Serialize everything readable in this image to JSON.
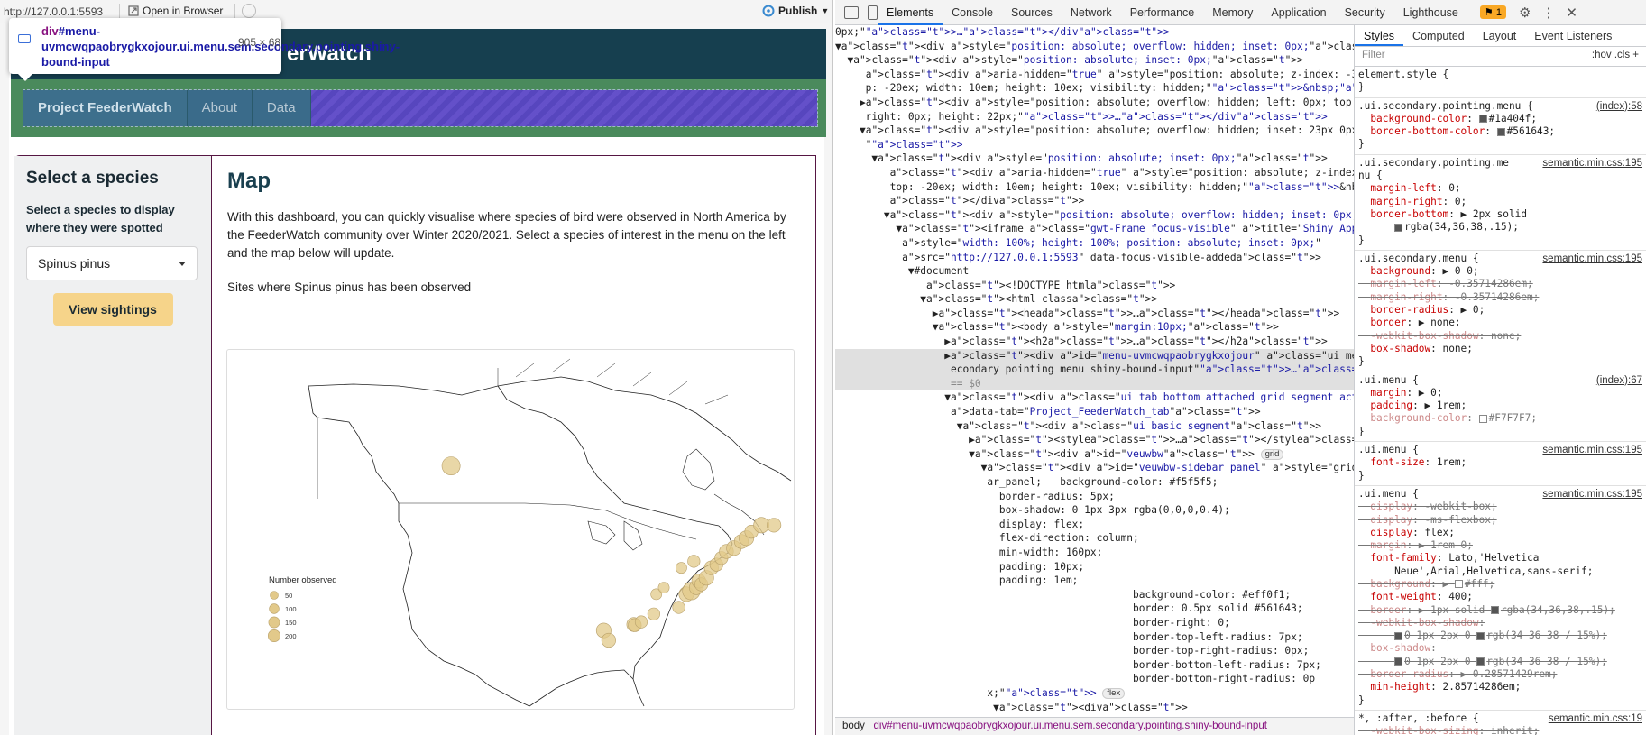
{
  "viewer": {
    "url": "http://127.0.0.1:5593",
    "open_in_browser": "Open in Browser",
    "publish": "Publish"
  },
  "tooltip": {
    "selector_tag": "div",
    "selector_rest": "#menu-uvmcwqpaobrygkxojour.ui.menu.sem.secondary.pointing.shiny-bound-input",
    "size": "905 × 68"
  },
  "app": {
    "title": "erWatch",
    "menu": [
      "Project FeederWatch",
      "About",
      "Data"
    ],
    "sidebar": {
      "heading": "Select a species",
      "label": "Select a species to display where they were spotted",
      "selected": "Spinus pinus",
      "button": "View sightings"
    },
    "main": {
      "heading": "Map",
      "intro": "With this dashboard, you can quickly visualise where species of bird were observed in North America by the FeederWatch community over Winter 2020/2021. Select a species of interest in the menu on the left and the map below will update.",
      "sites_text": "Sites where Spinus pinus has been observed"
    },
    "legend": {
      "title": "Number observed",
      "values": [
        "50",
        "100",
        "150",
        "200"
      ]
    }
  },
  "devtools": {
    "tabs": [
      "Elements",
      "Console",
      "Sources",
      "Network",
      "Performance",
      "Memory",
      "Application",
      "Security",
      "Lighthouse"
    ],
    "issues_badge": "1",
    "breadcrumb": [
      "body",
      "div#menu-uvmcwqpaobrygkxojour.ui.menu.sem.secondary.pointing.shiny-bound-input"
    ],
    "style_tabs": [
      "Styles",
      "Computed",
      "Layout",
      "Event Listeners"
    ],
    "filter_placeholder": "Filter",
    "filter_right": ":hov  .cls  +",
    "dom_lines": [
      "0px;\">…</div>",
      "▼<div style=\"position: absolute; overflow: hidden; inset: 0px;\">",
      "  ▼<div style=\"position: absolute; inset: 0px;\">",
      "     <div aria-hidden=\"true\" style=\"position: absolute; z-index: -32767; to",
      "     p: -20ex; width: 10em; height: 10ex; visibility: hidden;\">&nbsp;</div>",
      "    ▶<div style=\"position: absolute; overflow: hidden; left: 0px; top: 0px;",
      "     right: 0px; height: 22px;\">…</div>",
      "    ▼<div style=\"position: absolute; overflow: hidden; inset: 23px 0px 0px;",
      "     \">",
      "      ▼<div style=\"position: absolute; inset: 0px;\">",
      "         <div aria-hidden=\"true\" style=\"position: absolute; z-index: -32767;",
      "         top: -20ex; width: 10em; height: 10ex; visibility: hidden;\">&nbsp;",
      "         </div>",
      "        ▼<div style=\"position: absolute; overflow: hidden; inset: 0px;\">",
      "          ▼<iframe class=\"gwt-Frame focus-visible\" title=\"Shiny Application\"",
      "           style=\"width: 100%; height: 100%; position: absolute; inset: 0px;\"",
      "           src=\"http://127.0.0.1:5593\" data-focus-visible-added>",
      "            ▼#document",
      "               <!DOCTYPE html>",
      "              ▼<html class>",
      "                ▶<head>…</head>",
      "                ▼<body style=\"margin:10px;\">",
      "                  ▶<h2>…</h2>",
      "                  ▶<div id=\"menu-uvmcwqpaobrygkxojour\" class=\"ui menu sem ui s",
      "                   econdary pointing menu shiny-bound-input\">…</div> flex",
      "                   == $0",
      "                  ▼<div class=\"ui tab bottom attached grid segment active\"",
      "                   data-tab=\"Project_FeederWatch_tab\">",
      "                    ▼<div class=\"ui basic segment\">",
      "                      ▶<style>…</style>",
      "                      ▼<div id=\"veuwbw\"> grid",
      "                        ▼<div id=\"veuwbw-sidebar_panel\" style=\"grid-area: sideb",
      "                         ar_panel;   background-color: #f5f5f5;",
      "                           border-radius: 5px;",
      "                           box-shadow: 0 1px 3px rgba(0,0,0,0.4);",
      "                           display: flex;",
      "                           flex-direction: column;",
      "                           min-width: 160px;",
      "                           padding: 10px;",
      "                           padding: 1em;",
      "                                                 background-color: #eff0f1;",
      "                                                 border: 0.5px solid #561643;",
      "                                                 border-right: 0;",
      "                                                 border-top-left-radius: 7px;",
      "                                                 border-top-right-radius: 0px;",
      "                                                 border-bottom-left-radius: 7px;",
      "                                                 border-bottom-right-radius: 0p",
      "                         x;\"> flex",
      "                          ▼<div>"
    ],
    "rules": [
      {
        "sel": "element.style {",
        "src": "",
        "props": [
          "}"
        ]
      },
      {
        "sel": ".ui.secondary.pointing.menu {",
        "src": "(index):58",
        "props": [
          "  background-color: ■#1a404f;",
          "  border-bottom-color: ■#561643;",
          "}"
        ]
      },
      {
        "sel": ".ui.secondary.pointing.me",
        "src": "semantic.min.css:195",
        "props": [
          "nu {",
          "  margin-left: 0;",
          "  margin-right: 0;",
          "  border-bottom: ▶ 2px solid",
          "      ■rgba(34,36,38,.15);",
          "}"
        ]
      },
      {
        "sel": ".ui.secondary.menu {",
        "src": "semantic.min.css:195",
        "props": [
          "  background: ▶ 0 0;",
          "~  margin-left: -0.35714286em;",
          "~  margin-right: -0.35714286em;",
          "  border-radius: ▶ 0;",
          "  border: ▶ none;",
          "~  -webkit-box-shadow: none;",
          "  box-shadow: none;",
          "}"
        ]
      },
      {
        "sel": ".ui.menu {",
        "src": "(index):67",
        "props": [
          "  margin: ▶ 0;",
          "  padding: ▶ 1rem;",
          "~  background-color: □#F7F7F7;",
          "}"
        ]
      },
      {
        "sel": ".ui.menu {",
        "src": "semantic.min.css:195",
        "props": [
          "  font-size: 1rem;",
          "}"
        ]
      },
      {
        "sel": ".ui.menu {",
        "src": "semantic.min.css:195",
        "props": [
          "~  display: -webkit-box;",
          "~  display: -ms-flexbox;",
          "  display: flex;",
          "~  margin: ▶ 1rem 0;",
          "  font-family: Lato,'Helvetica",
          "      Neue',Arial,Helvetica,sans-serif;",
          "~  background: ▶ □#fff;",
          "  font-weight: 400;",
          "~  border: ▶ 1px solid ■rgba(34,36,38,.15);",
          "~  -webkit-box-shadow:",
          "~      ■0 1px 2px 0 ■rgb(34 36 38 / 15%);",
          "~  box-shadow:",
          "~      ■0 1px 2px 0 ■rgb(34 36 38 / 15%);",
          "~  border-radius: ▶ 0.28571429rem;",
          "  min-height: 2.85714286em;",
          "}"
        ]
      },
      {
        "sel": "*, :after, :before {",
        "src": "semantic.min.css:19",
        "props": [
          "~  -webkit-box-sizing: inherit;"
        ]
      }
    ]
  },
  "map_points": [
    {
      "lon": -130.5,
      "lat": 54.5,
      "count": 120
    },
    {
      "lon": -100.0,
      "lat": 29.5,
      "count": 70
    },
    {
      "lon": -99.0,
      "lat": 28.0,
      "count": 60
    },
    {
      "lon": -94.0,
      "lat": 30.4,
      "count": 60
    },
    {
      "lon": -93.8,
      "lat": 30.3,
      "count": 50
    },
    {
      "lon": -92.5,
      "lat": 30.8,
      "count": 40
    },
    {
      "lon": -90.0,
      "lat": 32.0,
      "count": 40
    },
    {
      "lon": -89.5,
      "lat": 35.0,
      "count": 30
    },
    {
      "lon": -88.0,
      "lat": 36.0,
      "count": 30
    },
    {
      "lon": -85.0,
      "lat": 33.0,
      "count": 40
    },
    {
      "lon": -83.5,
      "lat": 35.0,
      "count": 70
    },
    {
      "lon": -82.5,
      "lat": 35.5,
      "count": 110
    },
    {
      "lon": -81.5,
      "lat": 36.0,
      "count": 60
    },
    {
      "lon": -81.0,
      "lat": 37.0,
      "count": 60
    },
    {
      "lon": -80.5,
      "lat": 36.5,
      "count": 50
    },
    {
      "lon": -79.5,
      "lat": 37.5,
      "count": 70
    },
    {
      "lon": -78.5,
      "lat": 39.0,
      "count": 60
    },
    {
      "lon": -77.5,
      "lat": 39.5,
      "count": 50
    },
    {
      "lon": -76.5,
      "lat": 40.5,
      "count": 50
    },
    {
      "lon": -75.5,
      "lat": 41.5,
      "count": 60
    },
    {
      "lon": -74.0,
      "lat": 42.0,
      "count": 70
    },
    {
      "lon": -72.5,
      "lat": 43.0,
      "count": 60
    },
    {
      "lon": -71.5,
      "lat": 43.5,
      "count": 70
    },
    {
      "lon": -70.5,
      "lat": 44.5,
      "count": 50
    },
    {
      "lon": -68.5,
      "lat": 45.5,
      "count": 80
    },
    {
      "lon": -66.0,
      "lat": 45.5,
      "count": 60
    },
    {
      "lon": -82.0,
      "lat": 40.0,
      "count": 40
    },
    {
      "lon": -84.5,
      "lat": 39.0,
      "count": 30
    }
  ]
}
